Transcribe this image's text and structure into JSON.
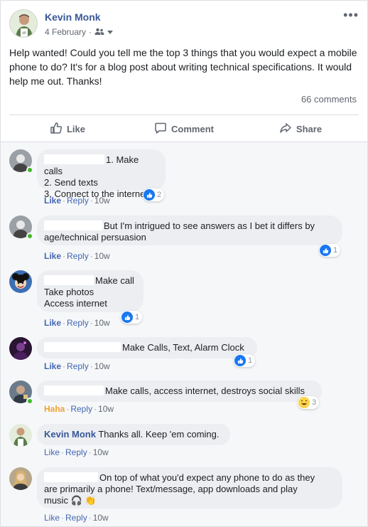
{
  "post": {
    "author": "Kevin Monk",
    "date": "4 February",
    "date_sep": "·",
    "text": "Help wanted! Could you tell me the top 3 things that you would expect a mobile phone to do? It's for a blog post about writing technical specifications. It would help me out. Thanks!",
    "comments_count": "66 comments",
    "more_icon": "•••"
  },
  "actions": {
    "like": "Like",
    "comment": "Comment",
    "share": "Share"
  },
  "comments": [
    {
      "name": "",
      "lines": [
        "1. Make calls",
        "2. Send texts",
        "3. Connect to the internet"
      ],
      "reaction_count": "2",
      "reaction_type": "like",
      "like_label": "Like",
      "reply_label": "Reply",
      "time": "10w"
    },
    {
      "name": "",
      "lines": [
        "But I'm intrigued to see answers as I bet it differs by",
        "age/technical persuasion"
      ],
      "reaction_count": "1",
      "reaction_type": "like",
      "like_label": "Like",
      "reply_label": "Reply",
      "time": "10w"
    },
    {
      "name": "",
      "lines": [
        "Make call",
        "Take photos",
        "Access internet"
      ],
      "reaction_count": "1",
      "reaction_type": "like",
      "like_label": "Like",
      "reply_label": "Reply",
      "time": "10w"
    },
    {
      "name": "",
      "lines": [
        "Make Calls, Text, Alarm Clock"
      ],
      "reaction_count": "1",
      "reaction_type": "like",
      "like_label": "Like",
      "reply_label": "Reply",
      "time": "10w"
    },
    {
      "name": "",
      "lines": [
        "Make calls, access internet, destroys social skills"
      ],
      "reaction_count": "3",
      "reaction_type": "haha",
      "like_label": "Haha",
      "reply_label": "Reply",
      "time": "10w"
    },
    {
      "name": "Kevin Monk",
      "lines": [
        "Thanks all. Keep 'em coming."
      ],
      "reaction_count": "",
      "reaction_type": "none",
      "like_label": "Like",
      "reply_label": "Reply",
      "time": "10w"
    },
    {
      "name": "",
      "lines": [
        "On top of what you'd expect any phone to do as they",
        "are primarily a phone! Text/message, app downloads and play",
        "music 🎧 👏"
      ],
      "reaction_count": "",
      "reaction_type": "none",
      "like_label": "Like",
      "reply_label": "Reply",
      "time": "10w"
    }
  ],
  "icons": {
    "audience": "friends-icon",
    "like_action": "thumbs-up-icon",
    "comment_action": "speech-bubble-icon",
    "share_action": "share-arrow-icon"
  },
  "colors": {
    "link_blue": "#385898",
    "like_blue": "#4267b2",
    "online_green": "#42b72a",
    "haha_orange": "#f0a22f"
  }
}
